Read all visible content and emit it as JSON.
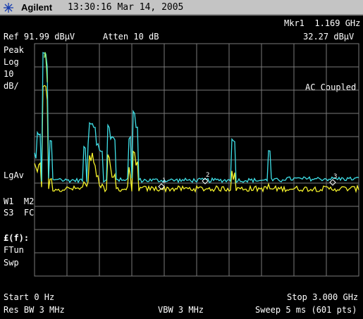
{
  "header": {
    "brand": "Agilent",
    "time": "13:30:16",
    "date": "Mar 14, 2005",
    "logo_icon": "agilent-spark-icon"
  },
  "marker": {
    "label": "Mkr1",
    "frequency": "1.169 GHz",
    "amplitude": "32.27 dBμV"
  },
  "ref": {
    "label": "Ref 91.99 dBμV",
    "atten": "Atten 10 dB"
  },
  "left_panel": {
    "detector": "Peak",
    "scale_type": "Log",
    "scale_value": "10",
    "scale_unit": "dB/",
    "averaging": "LgAv",
    "trace_line1": "W1  M2",
    "trace_line2": "S3  FC",
    "func_line": "£(f):",
    "ftun": "FTun",
    "swp": "Swp"
  },
  "coupling": "AC Coupled",
  "footer": {
    "start": "Start 0 Hz",
    "stop": "Stop 3.000 GHz",
    "res_bw": "Res BW 3 MHz",
    "vbw": "VBW 3 MHz",
    "sweep": "Sweep 5 ms (601 pts)"
  },
  "markers": [
    "1",
    "2",
    "3"
  ],
  "colors": {
    "background": "#000000",
    "grid": "#7a7a7a",
    "trace_peak": "#3fe0e8",
    "trace_avg": "#f4f12a",
    "trace_green": "#9cf070",
    "text": "#ffffff"
  }
}
